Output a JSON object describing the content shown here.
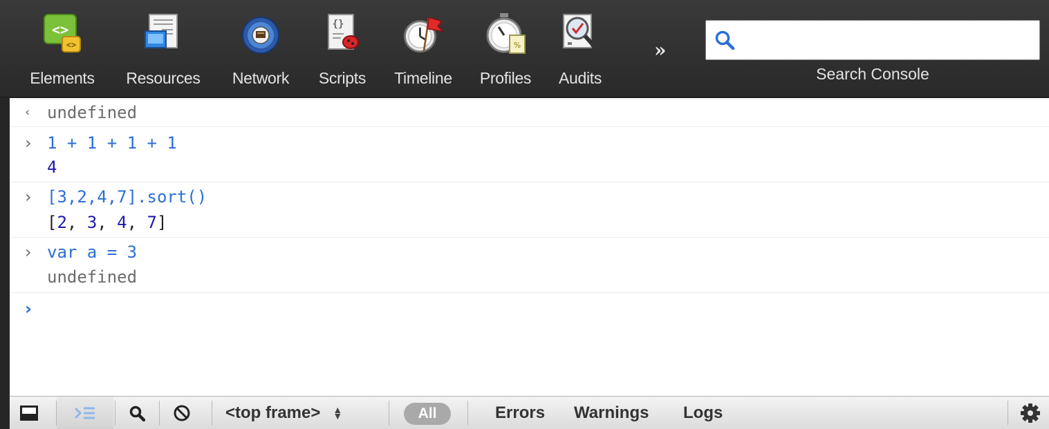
{
  "toolbar": {
    "tabs": [
      {
        "label": "Elements",
        "icon": "elements-icon"
      },
      {
        "label": "Resources",
        "icon": "resources-icon"
      },
      {
        "label": "Network",
        "icon": "network-icon"
      },
      {
        "label": "Scripts",
        "icon": "scripts-icon"
      },
      {
        "label": "Timeline",
        "icon": "timeline-icon"
      },
      {
        "label": "Profiles",
        "icon": "profiles-icon"
      },
      {
        "label": "Audits",
        "icon": "audits-icon"
      }
    ],
    "more_label": "»",
    "search": {
      "placeholder": "",
      "value": "",
      "caption": "Search Console"
    }
  },
  "console": {
    "entries": [
      {
        "kind": "result",
        "text": "undefined"
      },
      {
        "kind": "command",
        "text": "1 + 1 + 1 + 1",
        "result": "4"
      },
      {
        "kind": "command",
        "text": "[3,2,4,7].sort()",
        "result_parts": [
          "[",
          "2",
          ", ",
          "3",
          ", ",
          "4",
          ", ",
          "7",
          "]"
        ]
      },
      {
        "kind": "command",
        "text": "var a = 3",
        "result": "undefined"
      },
      {
        "kind": "prompt",
        "text": ""
      }
    ]
  },
  "statusbar": {
    "frame_select": "<top frame>",
    "filters": {
      "all": "All",
      "errors": "Errors",
      "warnings": "Warnings",
      "logs": "Logs"
    }
  },
  "colors": {
    "toolbar_bg": "#333333",
    "console_input": "#2a6fd6",
    "console_number": "#1c1aa9",
    "console_gray": "#6b6b6b"
  }
}
